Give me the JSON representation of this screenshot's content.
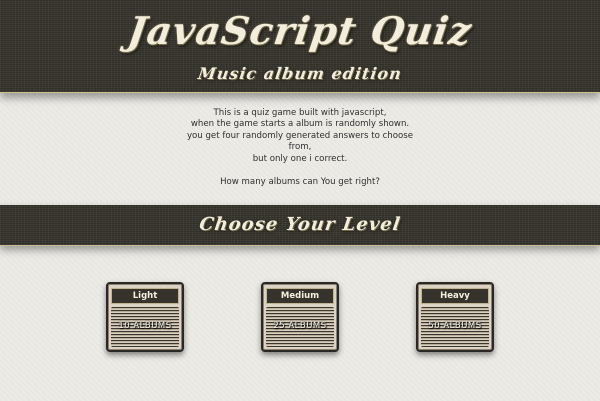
{
  "header": {
    "title": "JavaScript Quiz",
    "subtitle": "Music album edition"
  },
  "intro": {
    "lines": [
      "This is a quiz game built with javascript,",
      "when the game starts a album is randomly shown.",
      "you get four randomly generated answers to choose",
      "from,",
      "but only one i correct."
    ],
    "question": "How many albums can You get right?"
  },
  "level_section": {
    "title": "Choose Your Level"
  },
  "levels": [
    {
      "name": "Light",
      "count": "10 ALBUMS"
    },
    {
      "name": "Medium",
      "count": "25 ALBUMS"
    },
    {
      "name": "Heavy",
      "count": "50 ALBUMS"
    }
  ],
  "colors": {
    "band": "#35332b",
    "page_background": "#ecebe6",
    "title_text": "#f3eedb",
    "card_border": "#2a2824"
  }
}
